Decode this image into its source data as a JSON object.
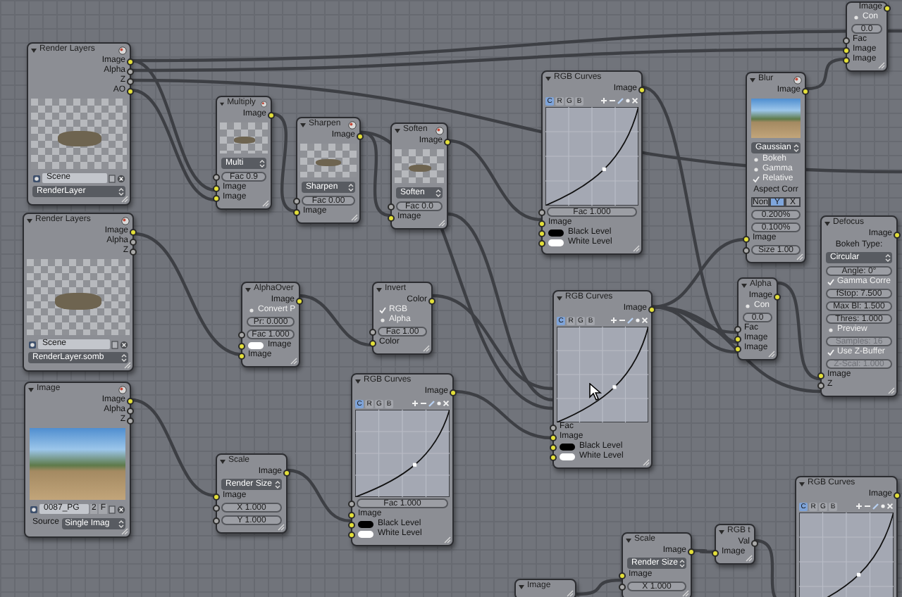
{
  "nodes": [
    {
      "title": "Render Layers",
      "rows": [
        {
          "kind": "output",
          "label": "Image",
          "socket": {
            "color": "#e3df3a"
          }
        },
        {
          "kind": "output",
          "label": "Alpha",
          "socket": {
            "color": "#a9a9a9"
          }
        },
        {
          "kind": "output",
          "label": "Z",
          "socket": {
            "color": "#a9a9a9"
          }
        },
        {
          "kind": "output",
          "label": "AO",
          "socket": {
            "color": "#e3df3a"
          }
        },
        {
          "kind": "preview"
        },
        {
          "kind": "datablock",
          "text": "Scene"
        },
        {
          "kind": "dropdown",
          "text": "RenderLayer"
        }
      ]
    },
    {
      "title": "Multiply",
      "rows": [
        {
          "kind": "output",
          "label": "Image",
          "socket": {
            "color": "#e3df3a"
          }
        },
        {
          "kind": "preview"
        },
        {
          "kind": "dropdown",
          "text": "Multi"
        },
        {
          "kind": "field",
          "text": "Fac 0.9",
          "socket": {
            "color": "#a9a9a9"
          },
          "disabled": false
        },
        {
          "kind": "input",
          "label": "Image",
          "socket": {
            "color": "#e3df3a"
          }
        },
        {
          "kind": "input",
          "label": "Image",
          "socket": {
            "color": "#e3df3a"
          }
        }
      ]
    },
    {
      "title": "Sharpen",
      "rows": [
        {
          "kind": "output",
          "label": "Image",
          "socket": {
            "color": "#e3df3a"
          }
        },
        {
          "kind": "preview"
        },
        {
          "kind": "dropdown",
          "text": "Sharpen"
        },
        {
          "kind": "field",
          "text": "Fac 0.00",
          "socket": {
            "color": "#a9a9a9"
          },
          "disabled": false
        },
        {
          "kind": "input",
          "label": "Image",
          "socket": {
            "color": "#e3df3a"
          }
        }
      ]
    },
    {
      "title": "Soften",
      "rows": [
        {
          "kind": "output",
          "label": "Image",
          "socket": {
            "color": "#e3df3a"
          }
        },
        {
          "kind": "preview"
        },
        {
          "kind": "dropdown",
          "text": "Soften"
        },
        {
          "kind": "field",
          "text": "Fac 0.0",
          "socket": {
            "color": "#a9a9a9"
          },
          "disabled": false
        },
        {
          "kind": "input",
          "label": "Image",
          "socket": {
            "color": "#e3df3a"
          }
        }
      ]
    },
    {
      "title": "RGB Curves",
      "rows": [
        {
          "kind": "output",
          "label": "Image",
          "socket": {
            "color": "#e3df3a"
          }
        },
        {
          "kind": "curve",
          "channels": [
            {
              "label": "C",
              "selected": true
            },
            {
              "label": "R",
              "selected": false
            },
            {
              "label": "G",
              "selected": false
            },
            {
              "label": "B",
              "selected": false
            }
          ]
        },
        {
          "kind": "field",
          "text": "Fac 1.000",
          "socket": {
            "color": "#a9a9a9"
          },
          "disabled": false
        },
        {
          "kind": "input",
          "label": "Image",
          "socket": {
            "color": "#e3df3a"
          }
        },
        {
          "kind": "swatch",
          "label": "Black Level",
          "color": "#000000",
          "socket": {
            "color": "#e3df3a"
          }
        },
        {
          "kind": "swatch",
          "label": "White Level",
          "color": "#ffffff",
          "socket": {
            "color": "#e3df3a"
          }
        }
      ]
    },
    {
      "title": "Blur",
      "rows": [
        {
          "kind": "output",
          "label": "Image",
          "socket": {
            "color": "#e3df3a"
          }
        },
        {
          "kind": "photo"
        },
        {
          "kind": "dropdown",
          "text": "Gaussian"
        },
        {
          "kind": "checkbox",
          "label": "Bokeh",
          "checked": false
        },
        {
          "kind": "checkbox",
          "label": "Gamma",
          "checked": false
        },
        {
          "kind": "checkbox",
          "label": "Relative",
          "checked": true
        },
        {
          "kind": "label",
          "text": "Aspect Corr"
        },
        {
          "kind": "segmented",
          "options": [
            {
              "label": "Non",
              "selected": false
            },
            {
              "label": "Y",
              "selected": true
            },
            {
              "label": "X",
              "selected": false
            }
          ]
        },
        {
          "kind": "field",
          "text": "0.200%",
          "disabled": false
        },
        {
          "kind": "field",
          "text": "0.100%",
          "disabled": false
        },
        {
          "kind": "input",
          "label": "Image",
          "socket": {
            "color": "#e3df3a"
          }
        },
        {
          "kind": "field",
          "text": "Size 1.00",
          "socket": {
            "color": "#a9a9a9"
          },
          "disabled": false
        }
      ]
    },
    {
      "rows": [
        {
          "kind": "output",
          "label": "Image",
          "socket": {
            "color": "#e3df3a"
          }
        },
        {
          "kind": "checkbox",
          "label": "Con",
          "checked": false
        },
        {
          "kind": "field",
          "text": "0.0",
          "disabled": false
        },
        {
          "kind": "input",
          "label": "Fac",
          "socket": {
            "color": "#a9a9a9"
          }
        },
        {
          "kind": "input",
          "label": "Image",
          "socket": {
            "color": "#e3df3a"
          }
        },
        {
          "kind": "input",
          "label": "Image",
          "socket": {
            "color": "#e3df3a"
          }
        }
      ]
    },
    {
      "title": "Render Layers",
      "rows": [
        {
          "kind": "output",
          "label": "Image",
          "socket": {
            "color": "#e3df3a"
          }
        },
        {
          "kind": "output",
          "label": "Alpha",
          "socket": {
            "color": "#a9a9a9"
          }
        },
        {
          "kind": "output",
          "label": "Z",
          "socket": {
            "color": "#a9a9a9"
          }
        },
        {
          "kind": "preview"
        },
        {
          "kind": "datablock",
          "text": "Scene"
        },
        {
          "kind": "dropdown",
          "text": "RenderLayer.somb"
        }
      ]
    },
    {
      "title": "AlphaOver",
      "rows": [
        {
          "kind": "output",
          "label": "Image",
          "socket": {
            "color": "#e3df3a"
          }
        },
        {
          "kind": "checkbox",
          "label": "Convert P",
          "checked": false
        },
        {
          "kind": "field",
          "text": "Pr: 0.000",
          "disabled": false
        },
        {
          "kind": "field",
          "text": "Fac 1.000",
          "socket": {
            "color": "#a9a9a9"
          },
          "disabled": false
        },
        {
          "kind": "swatch",
          "label": "Image",
          "color": "#ffffff",
          "socket": {
            "color": "#e3df3a"
          }
        },
        {
          "kind": "input",
          "label": "Image",
          "socket": {
            "color": "#e3df3a"
          }
        }
      ]
    },
    {
      "title": "Invert",
      "rows": [
        {
          "kind": "output",
          "label": "Color",
          "socket": {
            "color": "#e3df3a"
          }
        },
        {
          "kind": "checkbox",
          "label": "RGB",
          "checked": true
        },
        {
          "kind": "checkbox",
          "label": "Alpha",
          "checked": false
        },
        {
          "kind": "field",
          "text": "Fac 1.00",
          "socket": {
            "color": "#a9a9a9"
          },
          "disabled": false
        },
        {
          "kind": "input",
          "label": "Color",
          "socket": {
            "color": "#e3df3a"
          }
        }
      ]
    },
    {
      "title": "RGB Curves",
      "rows": [
        {
          "kind": "output",
          "label": "Image",
          "socket": {
            "color": "#e3df3a"
          }
        },
        {
          "kind": "curve",
          "channels": [
            {
              "label": "C",
              "selected": true
            },
            {
              "label": "R",
              "selected": false
            },
            {
              "label": "G",
              "selected": false
            },
            {
              "label": "B",
              "selected": false
            }
          ]
        },
        {
          "kind": "input",
          "label": "Fac",
          "socket": {
            "color": "#a9a9a9"
          }
        },
        {
          "kind": "input",
          "label": "Image",
          "socket": {
            "color": "#e3df3a"
          }
        },
        {
          "kind": "swatch",
          "label": "Black Level",
          "color": "#000000",
          "socket": {
            "color": "#e3df3a"
          }
        },
        {
          "kind": "swatch",
          "label": "White Level",
          "color": "#ffffff",
          "socket": {
            "color": "#e3df3a"
          }
        }
      ]
    },
    {
      "title": "Alpha",
      "rows": [
        {
          "kind": "output",
          "label": "Image",
          "socket": {
            "color": "#e3df3a"
          }
        },
        {
          "kind": "checkbox",
          "label": "Con",
          "checked": false
        },
        {
          "kind": "field",
          "text": "0.0",
          "disabled": false
        },
        {
          "kind": "input",
          "label": "Fac",
          "socket": {
            "color": "#a9a9a9"
          }
        },
        {
          "kind": "input",
          "label": "Image",
          "socket": {
            "color": "#e3df3a"
          }
        },
        {
          "kind": "input",
          "label": "Image",
          "socket": {
            "color": "#e3df3a"
          }
        }
      ]
    },
    {
      "title": "Defocus",
      "rows": [
        {
          "kind": "output",
          "label": "Image",
          "socket": {
            "color": "#e3df3a"
          }
        },
        {
          "kind": "label",
          "text": "Bokeh Type:"
        },
        {
          "kind": "dropdown",
          "text": "Circular"
        },
        {
          "kind": "field",
          "text": "Angle: 0°",
          "disabled": false
        },
        {
          "kind": "checkbox",
          "label": "Gamma Corre",
          "checked": true
        },
        {
          "kind": "field",
          "text": "fStop: 7.500",
          "disabled": false
        },
        {
          "kind": "field",
          "text": "Max Bl: 1.500",
          "disabled": false
        },
        {
          "kind": "field",
          "text": "Thres: 1.000",
          "disabled": false
        },
        {
          "kind": "checkbox",
          "label": "Preview",
          "checked": false
        },
        {
          "kind": "field",
          "text": "Samples: 16",
          "disabled": true
        },
        {
          "kind": "checkbox",
          "label": "Use Z-Buffer",
          "checked": true
        },
        {
          "kind": "field",
          "text": "Z-Scal: 1.000",
          "disabled": true
        },
        {
          "kind": "input",
          "label": "Image",
          "socket": {
            "color": "#e3df3a"
          }
        },
        {
          "kind": "input",
          "label": "Z",
          "socket": {
            "color": "#a9a9a9"
          }
        }
      ]
    },
    {
      "title": "Image",
      "rows": [
        {
          "kind": "output",
          "label": "Image",
          "socket": {
            "color": "#e3df3a"
          }
        },
        {
          "kind": "output",
          "label": "Alpha",
          "socket": {
            "color": "#a9a9a9"
          }
        },
        {
          "kind": "output",
          "label": "Z",
          "socket": {
            "color": "#a9a9a9"
          }
        },
        {
          "kind": "photo"
        },
        {
          "kind": "datablock",
          "text": "0087_PG",
          "users": "2",
          "fake": "F"
        },
        {
          "kind": "labeled-dropdown",
          "label": "Source",
          "text": "Single Imag"
        }
      ]
    },
    {
      "title": "Scale",
      "rows": [
        {
          "kind": "output",
          "label": "Image",
          "socket": {
            "color": "#e3df3a"
          }
        },
        {
          "kind": "dropdown",
          "text": "Render Size"
        },
        {
          "kind": "input",
          "label": "Image",
          "socket": {
            "color": "#e3df3a"
          }
        },
        {
          "kind": "field",
          "text": "X 1.000",
          "socket": {
            "color": "#a9a9a9"
          },
          "disabled": false
        },
        {
          "kind": "field",
          "text": "Y 1.000",
          "socket": {
            "color": "#a9a9a9"
          },
          "disabled": false
        }
      ]
    },
    {
      "title": "RGB Curves",
      "rows": [
        {
          "kind": "output",
          "label": "Image",
          "socket": {
            "color": "#e3df3a"
          }
        },
        {
          "kind": "curve",
          "channels": [
            {
              "label": "C",
              "selected": true
            },
            {
              "label": "R",
              "selected": false
            },
            {
              "label": "G",
              "selected": false
            },
            {
              "label": "B",
              "selected": false
            }
          ]
        },
        {
          "kind": "field",
          "text": "Fac 1.000",
          "socket": {
            "color": "#a9a9a9"
          },
          "disabled": false
        },
        {
          "kind": "input",
          "label": "Image",
          "socket": {
            "color": "#e3df3a"
          }
        },
        {
          "kind": "swatch",
          "label": "Black Level",
          "color": "#000000",
          "socket": {
            "color": "#e3df3a"
          }
        },
        {
          "kind": "swatch",
          "label": "White Level",
          "color": "#ffffff",
          "socket": {
            "color": "#e3df3a"
          }
        }
      ]
    },
    {
      "title": "Image"
    },
    {
      "title": "Scale",
      "rows": [
        {
          "kind": "output",
          "label": "Image",
          "socket": {
            "color": "#e3df3a"
          }
        },
        {
          "kind": "dropdown",
          "text": "Render Size"
        },
        {
          "kind": "input",
          "label": "Image",
          "socket": {
            "color": "#e3df3a"
          }
        },
        {
          "kind": "field",
          "text": "X 1.000",
          "socket": {
            "color": "#a9a9a9"
          },
          "disabled": false
        }
      ]
    },
    {
      "title": "RGB t",
      "rows": [
        {
          "kind": "output",
          "label": "Val",
          "socket": {
            "color": "#a9a9a9"
          }
        },
        {
          "kind": "input",
          "label": "Image",
          "socket": {
            "color": "#e3df3a"
          }
        }
      ]
    },
    {
      "title": "RGB Curves",
      "rows": [
        {
          "kind": "output",
          "label": "Image",
          "socket": {
            "color": "#e3df3a"
          }
        },
        {
          "kind": "curve",
          "channels": [
            {
              "label": "C",
              "selected": true
            },
            {
              "label": "R",
              "selected": false
            },
            {
              "label": "G",
              "selected": false
            },
            {
              "label": "B",
              "selected": false
            }
          ]
        }
      ]
    }
  ]
}
